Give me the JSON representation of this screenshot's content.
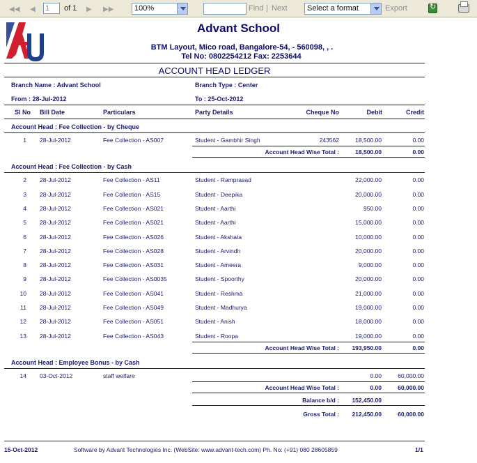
{
  "toolbar": {
    "first_icon": "first-page-icon",
    "prev_icon": "previous-page-icon",
    "page_value": "1",
    "of_label": "of 1",
    "next_icon": "next-page-icon",
    "last_icon": "last-page-icon",
    "zoom_value": "100%",
    "find_label": "Find",
    "separator": "|",
    "next_label": "Next",
    "format_value": "Select a format",
    "export_label": "Export"
  },
  "header": {
    "school_name": "Advant School",
    "address": "BTM Layout, Mico road, Bangalore-54, - 560098, , .",
    "tel": "Tel No: 0802254212 Fax: 2253644",
    "logo_letters": "AU",
    "title": "ACCOUNT HEAD LEDGER"
  },
  "info": {
    "branch_name": "Branch Name : Advant School",
    "branch_type": "Branch Type : Center",
    "from": "From : 28-Jul-2012",
    "to": "To : 25-Oct-2012"
  },
  "columns": [
    "Sl No",
    "Bill Date",
    "Particulars",
    "Party Details",
    "Cheque No",
    "Debit",
    "Credit"
  ],
  "groups": [
    {
      "head": "Account Head : Fee Collection - by Cheque",
      "rows": [
        [
          "1",
          "28-Jul-2012",
          "Fee Collection - AS007",
          "Student - Gambhir Singh",
          "243562",
          "18,500.00",
          "0.00"
        ]
      ],
      "total_label": "Account Head Wise Total :",
      "total_debit": "18,500.00",
      "total_credit": "0.00"
    },
    {
      "head": "Account Head : Fee Collection - by Cash",
      "rows": [
        [
          "2",
          "28-Jul-2012",
          "Fee Collection - AS11",
          "Student - Ramprasad",
          "",
          "22,000.00",
          "0.00"
        ],
        [
          "3",
          "28-Jul-2012",
          "Fee Collection - AS15",
          "Student - Deepika",
          "",
          "20,000.00",
          "0.00"
        ],
        [
          "4",
          "28-Jul-2012",
          "Fee Collection - AS021",
          "Student - Aarthi",
          "",
          "950.00",
          "0.00"
        ],
        [
          "5",
          "28-Jul-2012",
          "Fee Collection - AS021",
          "Student - Aarthi",
          "",
          "15,000.00",
          "0.00"
        ],
        [
          "6",
          "28-Jul-2012",
          "Fee Collection - AS026",
          "Student - Akshata",
          "",
          "10,000.00",
          "0.00"
        ],
        [
          "7",
          "28-Jul-2012",
          "Fee Collection - AS028",
          "Student - Arvindh",
          "",
          "20,000.00",
          "0.00"
        ],
        [
          "8",
          "28-Jul-2012",
          "Fee Collection - AS031",
          "Student - Ameera",
          "",
          "9,000.00",
          "0.00"
        ],
        [
          "9",
          "28-Jul-2012",
          "Fee Collection - AS0035",
          "Student - Spoorthy",
          "",
          "20,000.00",
          "0.00"
        ],
        [
          "10",
          "28-Jul-2012",
          "Fee Collection - AS041",
          "Student - Reshma",
          "",
          "21,000.00",
          "0.00"
        ],
        [
          "11",
          "28-Jul-2012",
          "Fee Collection - AS049",
          "Student - Madhurya",
          "",
          "19,000.00",
          "0.00"
        ],
        [
          "12",
          "28-Jul-2012",
          "Fee Collection - AS051",
          "Student - Anish",
          "",
          "18,000.00",
          "0.00"
        ],
        [
          "13",
          "28-Jul-2012",
          "Fee Collection - AS043",
          "Student - Roopa",
          "",
          "19,000.00",
          "0.00"
        ]
      ],
      "total_label": "Account Head Wise Total :",
      "total_debit": "193,950.00",
      "total_credit": "0.00"
    },
    {
      "head": "Account Head : Employee Bonus - by Cash",
      "rows": [
        [
          "14",
          "03-Oct-2012",
          "staff welfare",
          "",
          "",
          "0.00",
          "60,000.00"
        ]
      ],
      "total_label": "Account Head Wise Total :",
      "total_debit": "0.00",
      "total_credit": "60,000.00"
    }
  ],
  "summary": {
    "balance_label": "Balance b/d :",
    "balance_value": "152,450.00",
    "gross_label": "Gross Total :",
    "gross_debit": "212,450.00",
    "gross_credit": "60,000.00"
  },
  "footer": {
    "date": "15-Oct-2012",
    "credit": "Software by Advant Technologies Inc. (WebSite: www.advant-tech.com) Ph. No: (+91) 080 28605859",
    "page": "1/1"
  },
  "colors": {
    "toolbar_bg": "#ece9d8",
    "text": "#1a1a6e",
    "logo_red": "#d01f2f",
    "logo_blue": "#1f3f8f"
  }
}
